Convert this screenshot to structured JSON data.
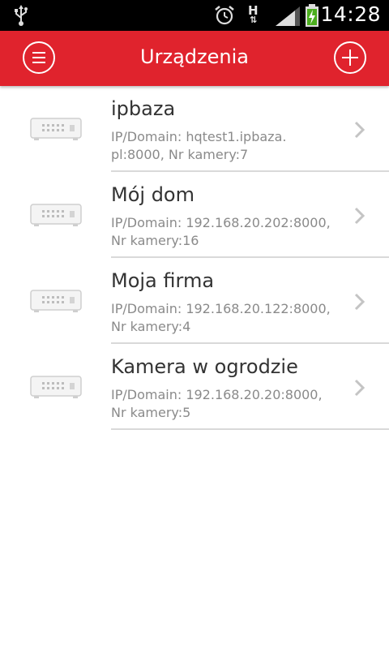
{
  "status_bar": {
    "time": "14:28",
    "icons": [
      "usb-icon",
      "alarm-icon",
      "hplus-data-icon",
      "signal-icon",
      "battery-charging-icon"
    ]
  },
  "header": {
    "title": "Urządzenia",
    "color": "#e0232d",
    "left_icon": "menu-icon",
    "right_icon": "add-icon"
  },
  "devices": [
    {
      "name": "ipbaza",
      "detail_line1": "IP/Domain: hqtest1.ipbaza.",
      "detail_line2": "pl:8000, Nr kamery:7"
    },
    {
      "name": "Mój dom",
      "detail_line1": "IP/Domain: 192.168.20.202:8000,",
      "detail_line2": "Nr kamery:16"
    },
    {
      "name": "Moja firma",
      "detail_line1": "IP/Domain: 192.168.20.122:8000,",
      "detail_line2": "Nr kamery:4"
    },
    {
      "name": "Kamera w ogrodzie",
      "detail_line1": "IP/Domain: 192.168.20.20:8000,",
      "detail_line2": "Nr kamery:5"
    }
  ]
}
